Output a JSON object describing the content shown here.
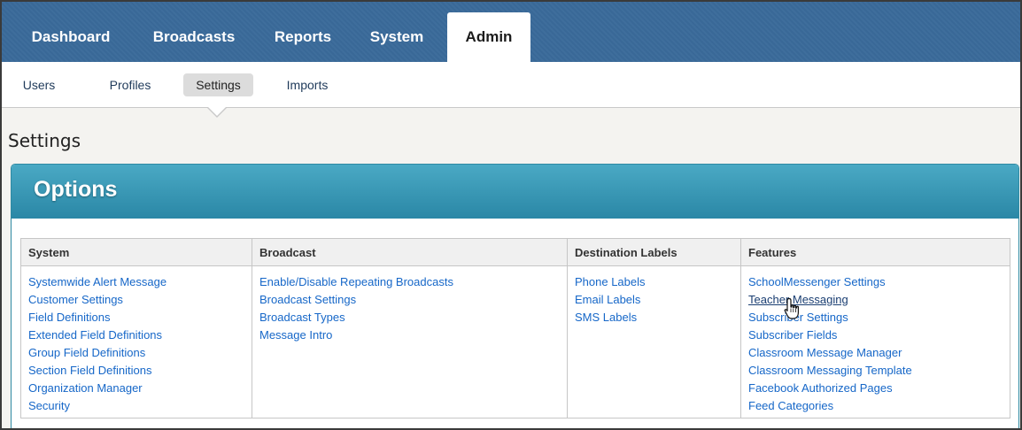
{
  "topnav": {
    "tabs": [
      {
        "label": "Dashboard",
        "active": false
      },
      {
        "label": "Broadcasts",
        "active": false
      },
      {
        "label": "Reports",
        "active": false
      },
      {
        "label": "System",
        "active": false
      },
      {
        "label": "Admin",
        "active": true
      }
    ]
  },
  "subnav": {
    "items": [
      {
        "label": "Users",
        "active": false
      },
      {
        "label": "Profiles",
        "active": false
      },
      {
        "label": "Settings",
        "active": true
      },
      {
        "label": "Imports",
        "active": false
      }
    ]
  },
  "page": {
    "title": "Settings"
  },
  "panel": {
    "title": "Options",
    "columns": [
      {
        "header": "System",
        "links": [
          "Systemwide Alert Message",
          "Customer Settings",
          "Field Definitions",
          "Extended Field Definitions",
          "Group Field Definitions",
          "Section Field Definitions",
          "Organization Manager",
          "Security"
        ]
      },
      {
        "header": "Broadcast",
        "links": [
          "Enable/Disable Repeating Broadcasts",
          "Broadcast Settings",
          "Broadcast Types",
          "Message Intro"
        ]
      },
      {
        "header": "Destination Labels",
        "links": [
          "Phone Labels",
          "Email Labels",
          "SMS Labels"
        ]
      },
      {
        "header": "Features",
        "links": [
          "SchoolMessenger Settings",
          "Teacher Messaging",
          "Subscriber Settings",
          "Subscriber Fields",
          "Classroom Message Manager",
          "Classroom Messaging Template",
          "Facebook Authorized Pages",
          "Feed Categories"
        ]
      }
    ]
  },
  "colors": {
    "nav_blue": "#3a6a9a",
    "panel_teal": "#2a87a6",
    "link_blue": "#1667c8"
  },
  "cursor": {
    "icon": "hand-pointer-icon"
  }
}
